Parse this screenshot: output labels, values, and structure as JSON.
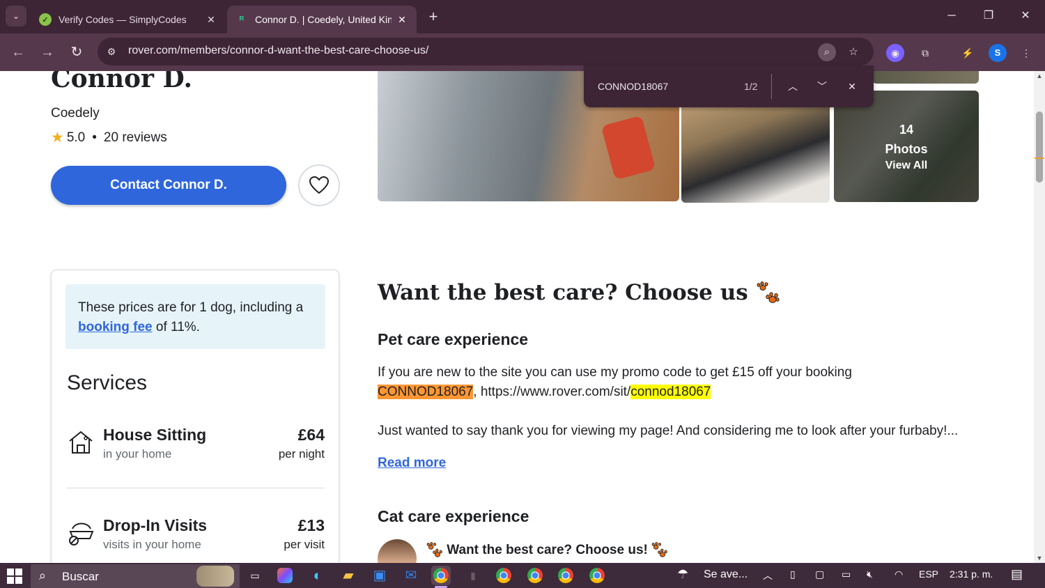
{
  "browser": {
    "tabs": [
      {
        "title": "Verify Codes — SimplyCodes",
        "icon": "simplycodes-icon"
      },
      {
        "title": "Connor D. | Coedely, United Kin",
        "icon": "rover-icon"
      }
    ],
    "url": "rover.com/members/connor-d-want-the-best-care-choose-us/",
    "profile_initial": "S"
  },
  "find": {
    "query": "CONNOD18067",
    "count": "1/2"
  },
  "profile": {
    "name": "Connor D.",
    "city": "Coedely",
    "rating": "5.0",
    "reviews": "20 reviews",
    "contact_label": "Contact Connor D."
  },
  "photos": {
    "count": "14",
    "label": "Photos",
    "view_all": "View All"
  },
  "pricing": {
    "notice_prefix": "These prices are for 1 dog, including a",
    "notice_link": "booking fee",
    "notice_suffix": "of 11%.",
    "services_title": "Services",
    "services": [
      {
        "name": "House Sitting",
        "sub": "in your home",
        "price": "£64",
        "unit": "per night"
      },
      {
        "name": "Drop-In Visits",
        "sub": "visits in your home",
        "price": "£13",
        "unit": "per visit"
      }
    ]
  },
  "about": {
    "title": "Want the best care? Choose us",
    "pet_heading": "Pet care experience",
    "pet_line1": "If you are new to the site you can use my promo code to get £15 off your booking",
    "pet_code": "CONNOD18067",
    "pet_sep": ", https://www.rover.com/sit/",
    "pet_code_lower": "connod18067",
    "pet_line3": "Just wanted to say thank you for viewing my page! And considering me to look after your furbaby!...",
    "read_more": "Read more",
    "cat_heading": "Cat care experience",
    "cat_line": "Want the best care? Choose us!"
  },
  "taskbar": {
    "search_placeholder": "Buscar",
    "weather": "Se ave...",
    "lang": "ESP",
    "time": "2:31 p. m."
  },
  "colors": {
    "accent": "#2f66dc",
    "highlight_current": "#ff9632",
    "highlight": "#ffff00",
    "chrome_frame": "#3d2536"
  }
}
